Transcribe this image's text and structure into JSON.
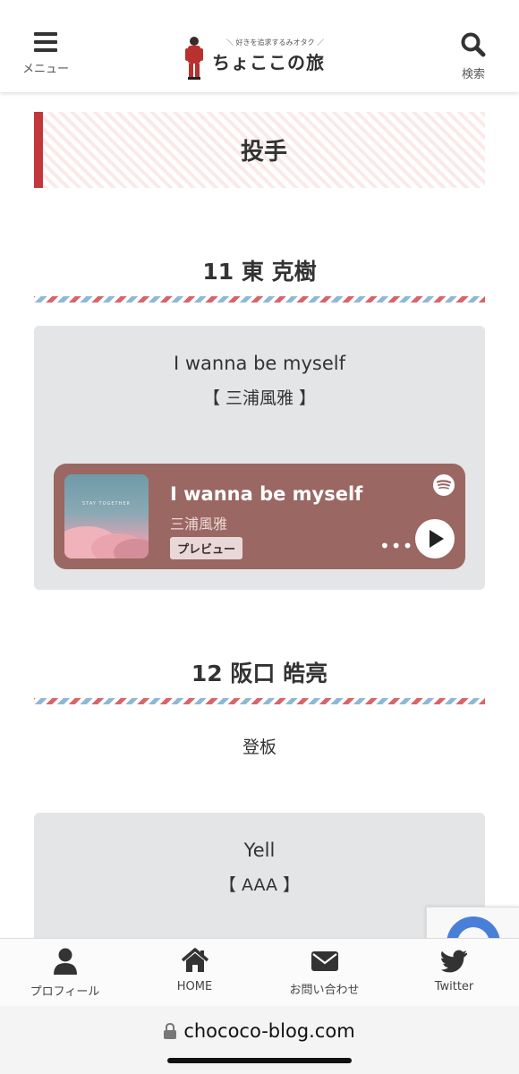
{
  "header": {
    "menu_label": "メニュー",
    "search_label": "検索",
    "logo_tagline": "＼ 好きを追求するみオタク ／",
    "logo_name": "ちょここの旅"
  },
  "page_title": "投手",
  "sections": [
    {
      "heading": "11 東 克樹",
      "song_title": "I wanna be myself",
      "song_artist": "【 三浦風雅 】",
      "player": {
        "cover_text": "STAY TOGETHER",
        "title": "I wanna be myself",
        "artist": "三浦風雅",
        "preview_label": "プレビュー",
        "more": "•••"
      }
    },
    {
      "heading": "12 阪口 皓亮",
      "note": "登板",
      "song_title": "Yell",
      "song_artist": "【 AAA 】"
    }
  ],
  "bottom_nav": [
    {
      "label": "プロフィール",
      "icon": "user-icon"
    },
    {
      "label": "HOME",
      "icon": "home-icon"
    },
    {
      "label": "お問い合わせ",
      "icon": "envelope-icon"
    },
    {
      "label": "Twitter",
      "icon": "twitter-icon"
    }
  ],
  "browser": {
    "url": "chococo-blog.com"
  },
  "colors": {
    "accent_red": "#c0373c",
    "airmail_blue": "#8fb8d6",
    "player_bg": "#9a6762",
    "box_bg": "#e4e5e7"
  }
}
